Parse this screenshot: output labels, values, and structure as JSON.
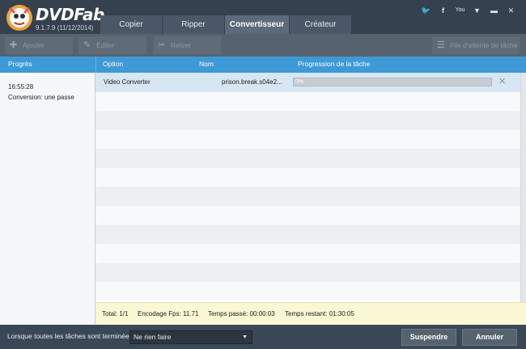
{
  "app": {
    "brand": "DVDFab",
    "version": "9.1.7.9 (11/12/2014)"
  },
  "window_controls": [
    "twitter",
    "facebook",
    "youtube",
    "menu",
    "minimize",
    "close"
  ],
  "tabs": [
    {
      "label": "Copier",
      "active": false
    },
    {
      "label": "Ripper",
      "active": false
    },
    {
      "label": "Convertisseur",
      "active": true
    },
    {
      "label": "Créateur",
      "active": false
    }
  ],
  "toolbar": {
    "ajouter": "Ajouter",
    "editer": "Éditer",
    "retirer": "Retirer",
    "file_attente": "File d'attente de tâche"
  },
  "headers": {
    "progres": "Progrès",
    "option": "Option",
    "nom": "Nom",
    "progression": "Progression de la tâche"
  },
  "left_panel": {
    "time": "16:55:28",
    "conversion": "Conversion: une passe"
  },
  "task": {
    "option": "Video Converter",
    "name": "prison.break.s04e2...",
    "progress_text": "0%",
    "progress": 0
  },
  "status": {
    "total": "Total: 1/1",
    "fps": "Encodage Fps: 11.71",
    "elapsed": "Temps passé: 00:00:03",
    "remaining": "Temps restant: 01:30:05"
  },
  "footer": {
    "label": "Lorsque toutes les tâches sont terminées:",
    "select_value": "Ne rien faire",
    "suspend": "Suspendre",
    "cancel": "Annuler"
  },
  "colors": {
    "header_bg": "#3d9ad6",
    "chrome_bg": "#3a4756",
    "status_bg": "#fbf6d4"
  }
}
